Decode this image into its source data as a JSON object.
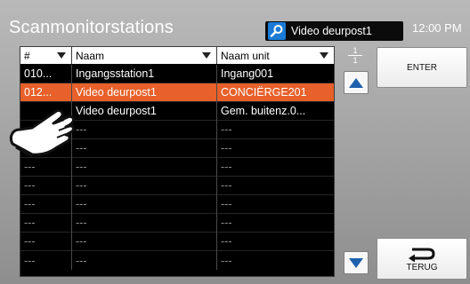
{
  "header": {
    "title": "Scanmonitorstations",
    "camera_label": "Video deurpost1",
    "clock": "12:00 PM"
  },
  "table": {
    "columns": [
      {
        "label": "#",
        "sortable": true
      },
      {
        "label": "Naam",
        "sortable": true
      },
      {
        "label": "Naam unit",
        "sortable": true
      }
    ],
    "rows": [
      {
        "num": "010...",
        "name": "Ingangsstation1",
        "unit": "Ingang001",
        "state": "normal"
      },
      {
        "num": "012...",
        "name": "Video deurpost1",
        "unit": "CONCIËRGE201",
        "state": "selected"
      },
      {
        "num": "",
        "name": "Video deurpost1",
        "unit": "Gem. buitenz.0...",
        "state": "normal"
      },
      {
        "num": "---",
        "name": "---",
        "unit": "---",
        "state": "dim"
      },
      {
        "num": "---",
        "name": "---",
        "unit": "---",
        "state": "dim"
      },
      {
        "num": "---",
        "name": "---",
        "unit": "---",
        "state": "dim"
      },
      {
        "num": "---",
        "name": "---",
        "unit": "---",
        "state": "dim"
      },
      {
        "num": "---",
        "name": "---",
        "unit": "---",
        "state": "dim"
      },
      {
        "num": "---",
        "name": "---",
        "unit": "---",
        "state": "dim"
      },
      {
        "num": "---",
        "name": "---",
        "unit": "---",
        "state": "dim"
      },
      {
        "num": "---",
        "name": "---",
        "unit": "---",
        "state": "dim"
      }
    ]
  },
  "pagination": {
    "current": "1",
    "total": "1"
  },
  "buttons": {
    "enter_label": "ENTER",
    "back_label": "TERUG"
  },
  "colors": {
    "selected_row": "#e8602a",
    "accent_blue": "#1f5fae",
    "camera_icon_bg": "#1b7bd6"
  },
  "icons": {
    "camera": "search-camera-icon",
    "scroll_up": "triangle-up-icon",
    "scroll_down": "triangle-down-icon",
    "back": "return-arrow-icon",
    "pointer": "pointing-hand-icon"
  }
}
